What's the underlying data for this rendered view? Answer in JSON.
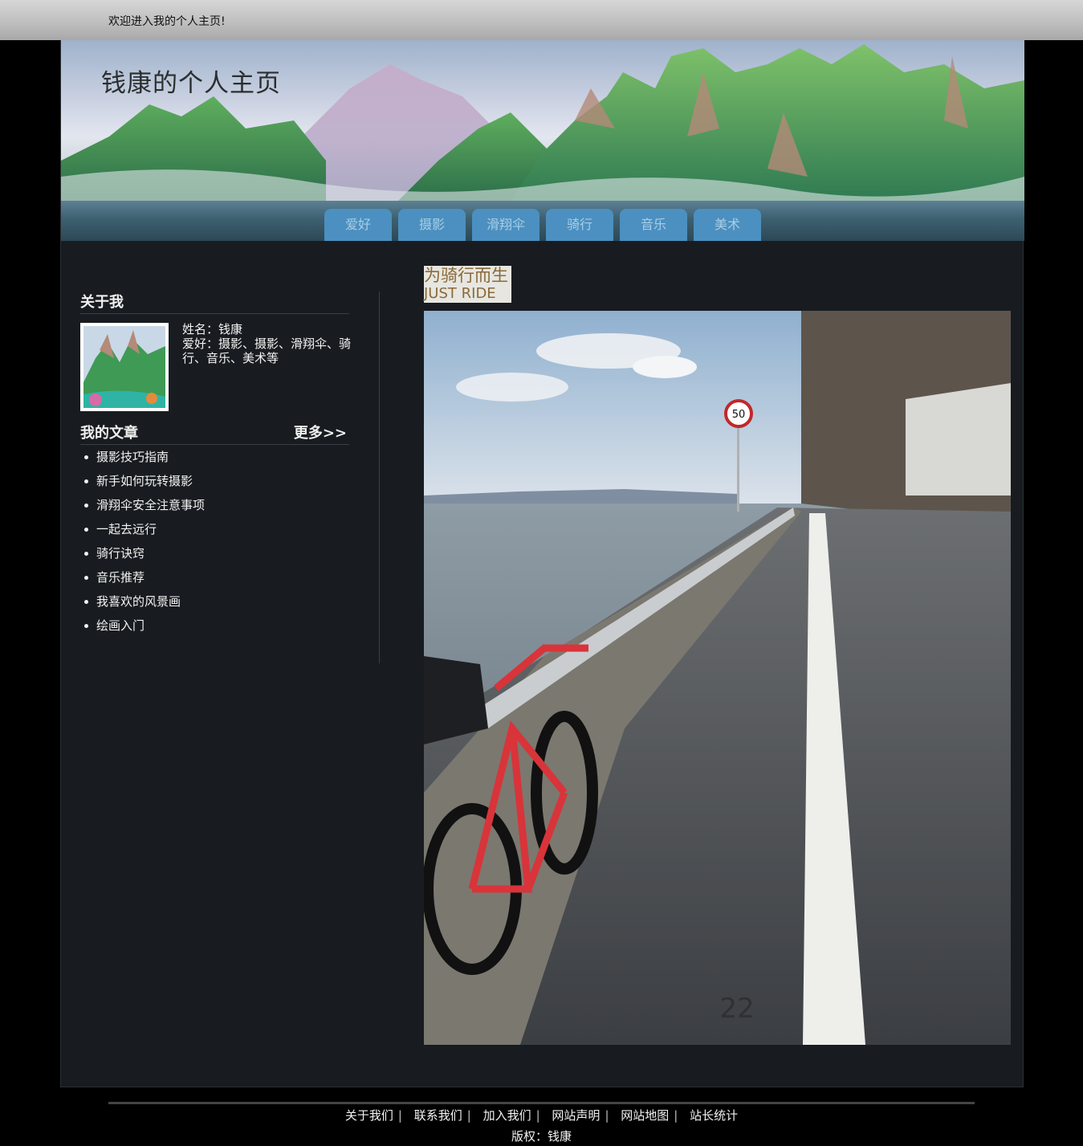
{
  "topbar": {
    "welcome": "欢迎进入我的个人主页!"
  },
  "header": {
    "site_title": "钱康的个人主页"
  },
  "nav": {
    "tabs": [
      "爱好",
      "摄影",
      "滑翔伞",
      "骑行",
      "音乐",
      "美术"
    ]
  },
  "about": {
    "title": "关于我",
    "name_line": "姓名：钱康",
    "hobby_line": "爱好：摄影、摄影、滑翔伞、骑行、音乐、美术等"
  },
  "articles": {
    "title": "我的文章",
    "more": "更多>>",
    "items": [
      "摄影技巧指南",
      "新手如何玩转摄影",
      "滑翔伞安全注意事项",
      "一起去远行",
      "骑行诀窍",
      "音乐推荐",
      "我喜欢的风景画",
      "绘画入门"
    ]
  },
  "main": {
    "caption_title": "为骑行而生",
    "caption_sub": "JUST RIDE",
    "photo_sign": "50",
    "photo_road_mark": "22"
  },
  "footer": {
    "links": [
      "关于我们",
      "联系我们",
      "加入我们",
      "网站声明",
      "网站地图",
      "站长统计"
    ],
    "copyright": "版权：钱康"
  }
}
